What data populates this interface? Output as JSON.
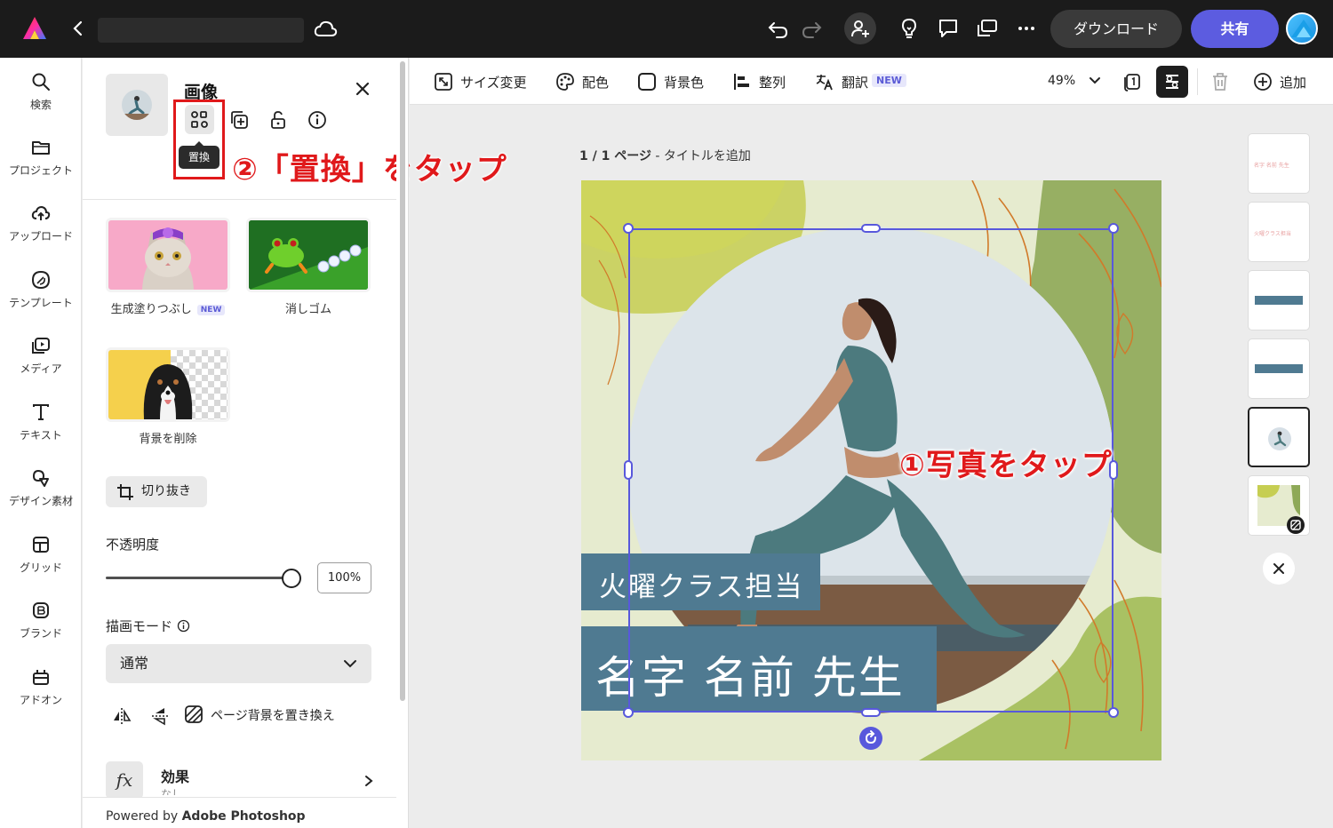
{
  "topbar": {
    "download_label": "ダウンロード",
    "share_label": "共有"
  },
  "rail": {
    "items": [
      {
        "label": "検索",
        "icon": "search-icon"
      },
      {
        "label": "プロジェクト",
        "icon": "folder-icon"
      },
      {
        "label": "アップロード",
        "icon": "cloud-upload-icon"
      },
      {
        "label": "テンプレート",
        "icon": "template-icon"
      },
      {
        "label": "メディア",
        "icon": "media-icon"
      },
      {
        "label": "テキスト",
        "icon": "text-icon"
      },
      {
        "label": "デザイン素材",
        "icon": "shapes-icon"
      },
      {
        "label": "グリッド",
        "icon": "grid-icon"
      },
      {
        "label": "ブランド",
        "icon": "brand-icon"
      },
      {
        "label": "アドオン",
        "icon": "addon-icon"
      }
    ]
  },
  "panel": {
    "title": "画像",
    "tooltip": "置換",
    "annotation_step2": "②「置換」をタップ",
    "features": [
      {
        "label": "生成塗りつぶし",
        "badge": "NEW"
      },
      {
        "label": "消しゴム"
      },
      {
        "label": "背景を削除"
      }
    ],
    "crop_label": "切り抜き",
    "opacity_label": "不透明度",
    "opacity_value": "100%",
    "opacity_fraction": 1.0,
    "blend_label": "描画モード",
    "blend_value": "通常",
    "bg_replace_label": "ページ背景を置き換え",
    "effects_title": "効果",
    "effects_sub": "なし",
    "footer_prefix": "Powered by ",
    "footer_brand": "Adobe Photoshop"
  },
  "toolbar": {
    "resize_label": "サイズ変更",
    "color_label": "配色",
    "bgcolor_label": "背景色",
    "align_label": "整列",
    "translate_label": "翻訳",
    "translate_badge": "NEW",
    "zoom": "49%",
    "add_label": "追加"
  },
  "canvas": {
    "page_label_bold": "1 / 1 ページ",
    "page_label_rest": " - タイトルを追加",
    "annotation_step1": "①写真をタップ",
    "class_text": "火曜クラス担当",
    "name_text": "名字 名前 先生"
  },
  "pages_strip": {
    "page1_text": "名字 名前 先生",
    "page2_text": "火曜クラス担当"
  },
  "colors": {
    "accent": "#5c5ce0",
    "annotation_red": "#e0191b",
    "band": "#4f7a91"
  }
}
